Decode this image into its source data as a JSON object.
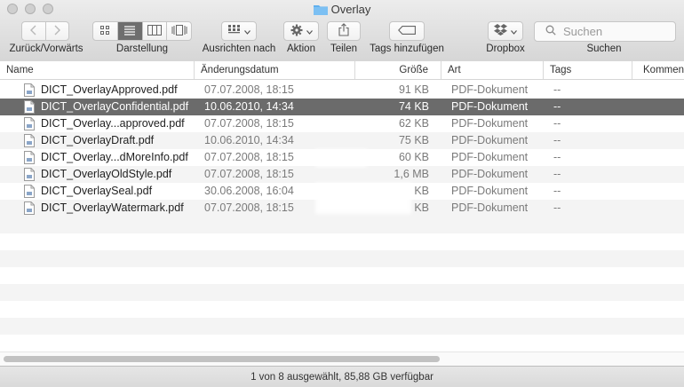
{
  "window": {
    "title": "Overlay"
  },
  "toolbar": {
    "nav_label": "Zurück/Vorwärts",
    "view_label": "Darstellung",
    "arrange_label": "Ausrichten nach",
    "action_label": "Aktion",
    "share_label": "Teilen",
    "tags_label": "Tags hinzufügen",
    "dropbox_label": "Dropbox",
    "search_label": "Suchen",
    "search_placeholder": "Suchen"
  },
  "columns": {
    "name": "Name",
    "date": "Änderungsdatum",
    "size": "Größe",
    "kind": "Art",
    "tags": "Tags",
    "comments": "Komment"
  },
  "files": [
    {
      "name": "DICT_OverlayApproved.pdf",
      "date": "07.07.2008, 18:15",
      "size": "91 KB",
      "kind": "PDF-Dokument",
      "tags": "--"
    },
    {
      "name": "DICT_OverlayConfidential.pdf",
      "date": "10.06.2010, 14:34",
      "size": "74 KB",
      "kind": "PDF-Dokument",
      "tags": "--"
    },
    {
      "name": "DICT_Overlay...approved.pdf",
      "date": "07.07.2008, 18:15",
      "size": "62 KB",
      "kind": "PDF-Dokument",
      "tags": "--"
    },
    {
      "name": "DICT_OverlayDraft.pdf",
      "date": "10.06.2010, 14:34",
      "size": "75 KB",
      "kind": "PDF-Dokument",
      "tags": "--"
    },
    {
      "name": "DICT_Overlay...dMoreInfo.pdf",
      "date": "07.07.2008, 18:15",
      "size": "60 KB",
      "kind": "PDF-Dokument",
      "tags": "--"
    },
    {
      "name": "DICT_OverlayOldStyle.pdf",
      "date": "07.07.2008, 18:15",
      "size": "1,6 MB",
      "kind": "PDF-Dokument",
      "tags": "--"
    },
    {
      "name": "DICT_OverlaySeal.pdf",
      "date": "30.06.2008, 16:04",
      "size": "KB",
      "kind": "PDF-Dokument",
      "tags": "--"
    },
    {
      "name": "DICT_OverlayWatermark.pdf",
      "date": "07.07.2008, 18:15",
      "size": "KB",
      "kind": "PDF-Dokument",
      "tags": "--"
    }
  ],
  "status": {
    "text": "1 von 8 ausgewählt, 85,88 GB verfügbar"
  }
}
